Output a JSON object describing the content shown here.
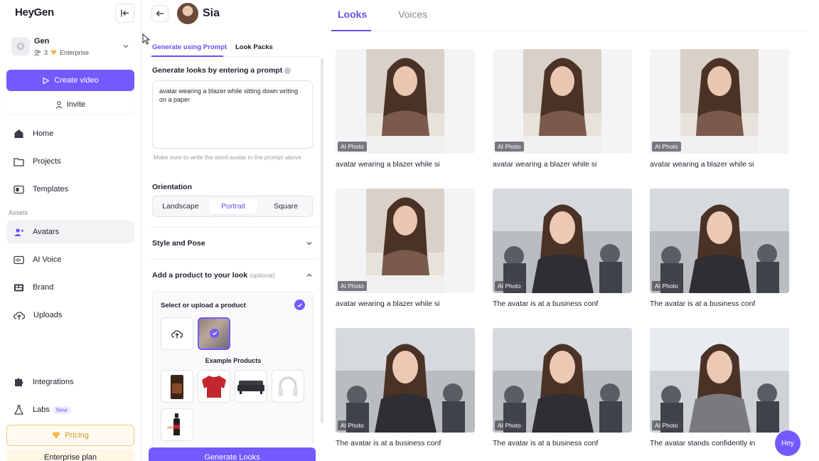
{
  "sidebar": {
    "logo": "HeyGen",
    "workspace": {
      "name": "Gen",
      "members": "3",
      "plan_badge": "Enterprise"
    },
    "create_video": "Create video",
    "invite": "Invite",
    "nav": [
      {
        "label": "Home",
        "icon": "home-icon"
      },
      {
        "label": "Projects",
        "icon": "folder-icon"
      },
      {
        "label": "Templates",
        "icon": "templates-icon"
      }
    ],
    "assets_section": "Assets",
    "assets": [
      {
        "label": "Avatars",
        "icon": "avatar-icon",
        "active": true
      },
      {
        "label": "AI Voice",
        "icon": "voice-icon"
      },
      {
        "label": "Brand",
        "icon": "brand-icon"
      },
      {
        "label": "Uploads",
        "icon": "upload-icon"
      }
    ],
    "integrations": "Integrations",
    "labs": "Labs",
    "labs_badge": "New",
    "pricing": "Pricing",
    "enterprise_plan": "Enterprise plan"
  },
  "panel": {
    "avatar_name": "Sia",
    "tabs": [
      "Generate using Prompt",
      "Look Packs"
    ],
    "prompt_label": "Generate looks by entering a prompt",
    "prompt_value": "avatar wearing a blazer while sitting down writing on a paper",
    "hint": "Make sure to write the word avatar in the prompt above.",
    "orientation_label": "Orientation",
    "orientations": [
      "Landscape",
      "Portrait",
      "Square"
    ],
    "orientation_selected": "Portrait",
    "style_pose": "Style and Pose",
    "product_header": "Add a product to your look",
    "product_optional": "(optional)",
    "select_upload": "Select or upload a product",
    "example_products": "Example Products",
    "generate_button": "Generate Looks"
  },
  "main": {
    "tabs": [
      "Looks",
      "Voices"
    ],
    "active_tab": "Looks",
    "ai_tag": "AI Photo",
    "cards": [
      {
        "caption": "avatar wearing a blazer while si",
        "scene": "desk"
      },
      {
        "caption": "avatar wearing a blazer while si",
        "scene": "desk"
      },
      {
        "caption": "avatar wearing a blazer while si",
        "scene": "desk"
      },
      {
        "caption": "avatar wearing a blazer while si",
        "scene": "desk"
      },
      {
        "caption": "The avatar is at a business conf",
        "scene": "conference"
      },
      {
        "caption": "The avatar is at a business conf",
        "scene": "conference"
      },
      {
        "caption": "The avatar is at a business conf",
        "scene": "conference"
      },
      {
        "caption": "The avatar is at a business conf",
        "scene": "conference"
      },
      {
        "caption": "The avatar stands confidently in",
        "scene": "office"
      }
    ]
  },
  "chat_button": "Hey",
  "colors": {
    "accent": "#7559ff",
    "accent_text": "#6a4df0",
    "gold": "#d89b28"
  }
}
